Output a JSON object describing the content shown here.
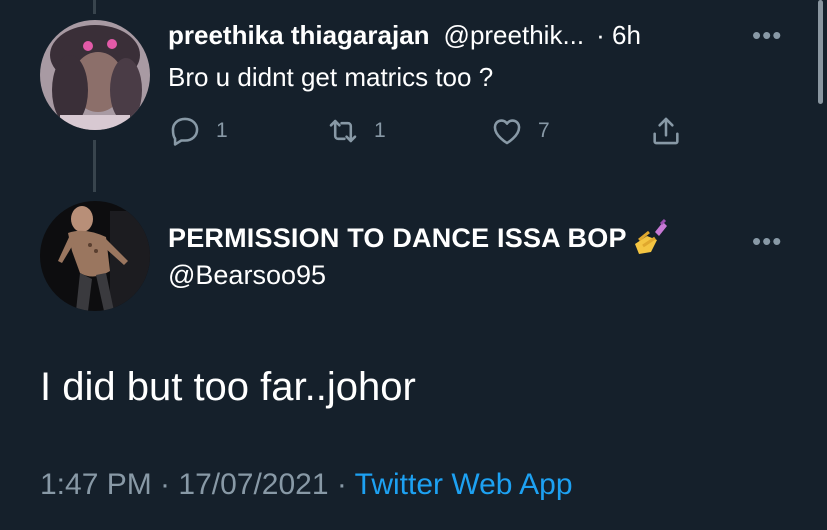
{
  "colors": {
    "background": "#15202b",
    "text": "#ffffff",
    "muted": "#8899a6",
    "accent": "#1da1f2",
    "thread_line": "#38444d"
  },
  "reply": {
    "display_name": "preethika thiagarajan",
    "handle": "@preethik...",
    "time": "· 6h",
    "text": "Bro u didnt get matrics too ?",
    "more_icon": "more-icon",
    "actions": {
      "reply_count": "1",
      "retweet_count": "1",
      "like_count": "7"
    }
  },
  "tweet": {
    "display_name": "PERMISSION TO DANCE ISSA BOP",
    "name_emoji": "nail-polish-emoji",
    "handle": "@Bearsoo95",
    "text": "I did but too far..johor",
    "timestamp": "1:47 PM · 17/07/2021 · ",
    "source": "Twitter Web App"
  }
}
